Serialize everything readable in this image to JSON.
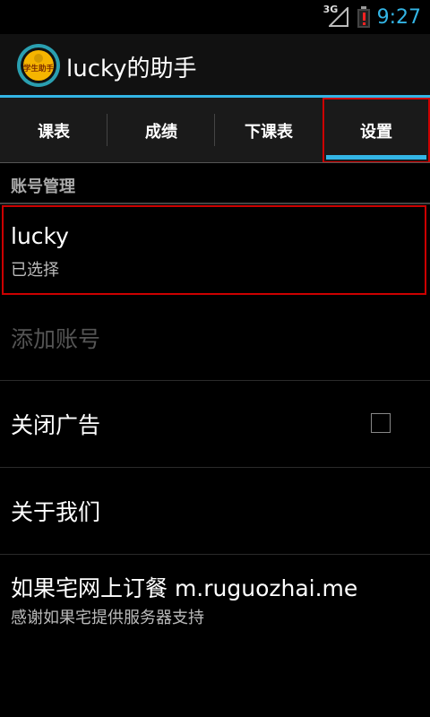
{
  "status_bar": {
    "network": "3G",
    "time": "9:27",
    "icons": [
      "signal-icon",
      "battery-alert-icon"
    ]
  },
  "action_bar": {
    "logo_text": "学生助手",
    "title": "lucky的助手"
  },
  "tabs": [
    {
      "label": "课表",
      "selected": false
    },
    {
      "label": "成绩",
      "selected": false
    },
    {
      "label": "下课表",
      "selected": false
    },
    {
      "label": "设置",
      "selected": true
    }
  ],
  "settings": {
    "section_header": "账号管理",
    "account": {
      "title": "lucky",
      "summary": "已选择"
    },
    "add_account": {
      "title": "添加账号",
      "enabled": false
    },
    "close_ads": {
      "title": "关闭广告",
      "checked": false
    },
    "about": {
      "title": "关于我们"
    },
    "ruguozhai": {
      "title": "如果宅网上订餐 m.ruguozhai.me",
      "summary": "感谢如果宅提供服务器支持"
    }
  },
  "colors": {
    "accent": "#33b5e5",
    "highlight": "#cc0000",
    "background": "#000000"
  }
}
